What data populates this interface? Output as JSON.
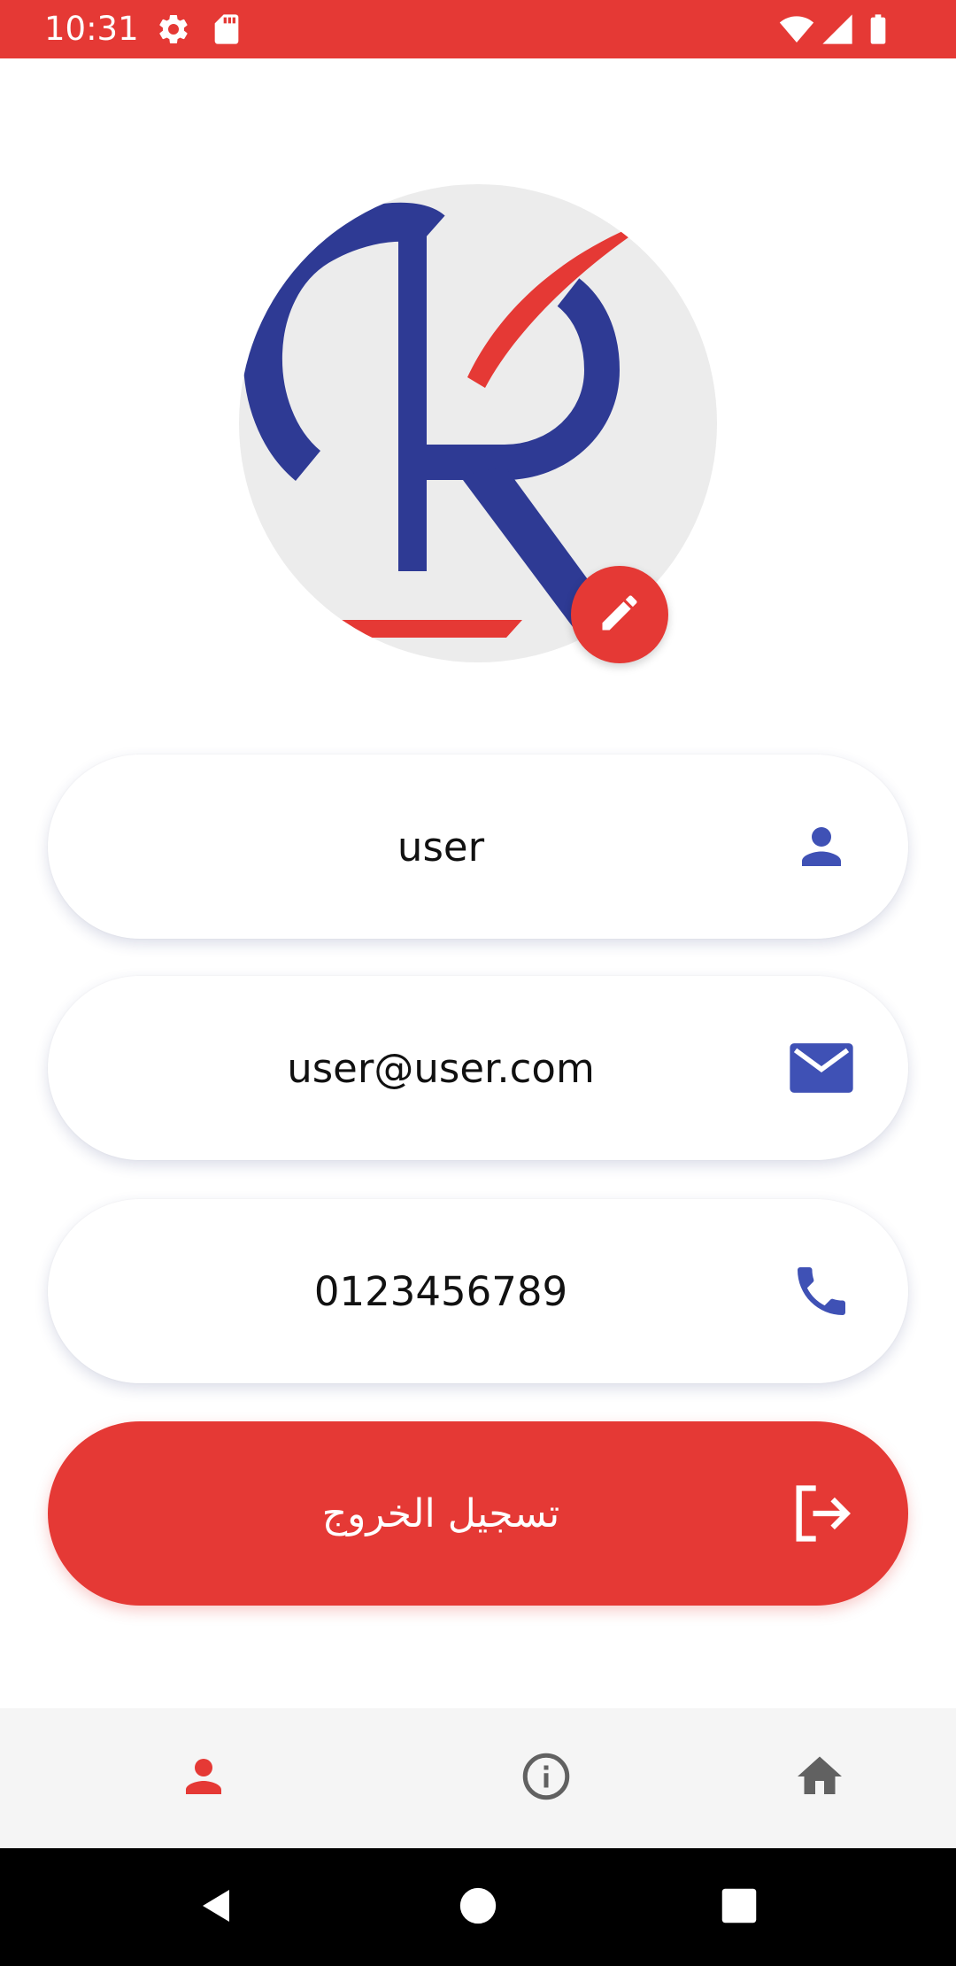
{
  "status_bar": {
    "time": "10:31",
    "background": "#e53935",
    "left_icons": [
      "gear-icon",
      "sd-card-icon"
    ],
    "right_icons": [
      "wifi-icon",
      "signal-icon",
      "battery-icon"
    ]
  },
  "profile": {
    "avatar_logo": "R",
    "edit_icon": "pencil-icon"
  },
  "fields": {
    "name": {
      "value": "user",
      "icon": "person-icon"
    },
    "email": {
      "value": "user@user.com",
      "icon": "mail-icon"
    },
    "phone": {
      "value": "0123456789",
      "icon": "phone-icon"
    }
  },
  "logout": {
    "label": "تسجيل الخروج",
    "icon": "logout-icon"
  },
  "bottom_nav": {
    "items": [
      {
        "name": "profile",
        "icon": "person-icon",
        "active": true
      },
      {
        "name": "info",
        "icon": "info-icon",
        "active": false
      },
      {
        "name": "home",
        "icon": "home-icon",
        "active": false
      }
    ]
  },
  "colors": {
    "accent_red": "#e53935",
    "icon_blue": "#3f51b5",
    "inactive_gray": "#616161"
  }
}
